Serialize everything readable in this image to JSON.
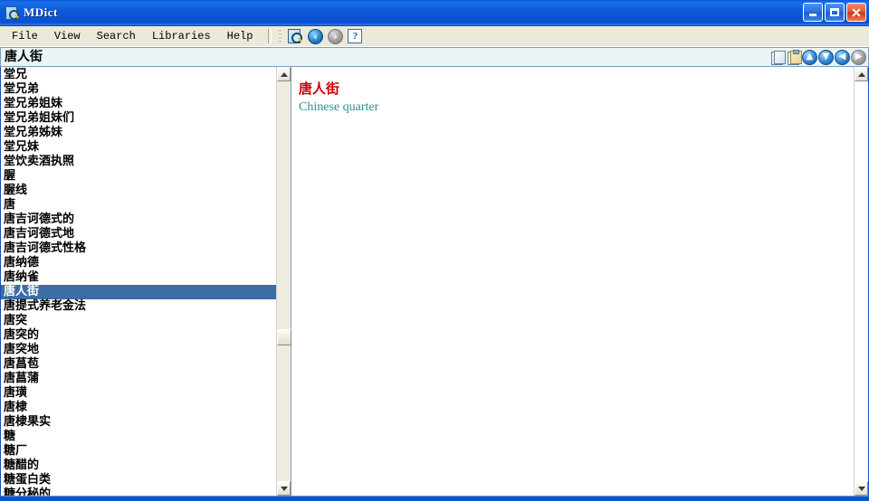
{
  "window": {
    "title": "MDict",
    "icon": "dictionary-magnifier-icon",
    "minimize_label": "Minimize",
    "maximize_label": "Maximize",
    "close_label": "Close"
  },
  "menu": {
    "items": [
      {
        "label": "File",
        "name": "file"
      },
      {
        "label": "View",
        "name": "view"
      },
      {
        "label": "Search",
        "name": "search"
      },
      {
        "label": "Libraries",
        "name": "libraries"
      },
      {
        "label": "Help",
        "name": "help"
      }
    ]
  },
  "toolbar": {
    "buttons": [
      {
        "name": "search-dictionary-icon",
        "glyph": ""
      },
      {
        "name": "back-icon",
        "glyph": "◀"
      },
      {
        "name": "forward-icon",
        "glyph": "▶"
      },
      {
        "name": "help-icon",
        "glyph": "?"
      }
    ]
  },
  "search": {
    "value": "唐人街",
    "placeholder": "",
    "tools": [
      {
        "name": "copy-icon",
        "glyph": ""
      },
      {
        "name": "paste-icon",
        "glyph": ""
      },
      {
        "name": "scroll-up-icon",
        "glyph": "▲"
      },
      {
        "name": "scroll-down-icon",
        "glyph": "▼"
      },
      {
        "name": "history-back-icon",
        "glyph": "◀"
      },
      {
        "name": "history-forward-icon",
        "glyph": "▶"
      }
    ]
  },
  "wordlist": {
    "selected_index": 15,
    "items": [
      "堂兄",
      "堂兄弟",
      "堂兄弟姐妹",
      "堂兄弟姐妹们",
      "堂兄弟姊妹",
      "堂兄妹",
      "堂饮卖酒执照",
      "腛",
      "腛线",
      "唐",
      "唐吉诃德式的",
      "唐吉诃德式地",
      "唐吉诃德式性格",
      "唐纳德",
      "唐纳雀",
      "唐人街",
      "唐提式养老金法",
      "唐突",
      "唐突的",
      "唐突地",
      "唐菖苞",
      "唐菖蒲",
      "唐璜",
      "唐棣",
      "唐棣果实",
      "糖",
      "糖厂",
      "糖醋的",
      "糖蛋白类",
      "糖分秘的"
    ]
  },
  "article": {
    "headword": "唐人街",
    "definition": "Chinese quarter"
  },
  "colors": {
    "titlebar_blue": "#0f5ad9",
    "selection_blue": "#3a6ea5",
    "headword_red": "#cc0000",
    "definition_teal": "#2a8f8f",
    "menubar_bg": "#ece9d8",
    "search_bg": "#eaf4f7"
  }
}
